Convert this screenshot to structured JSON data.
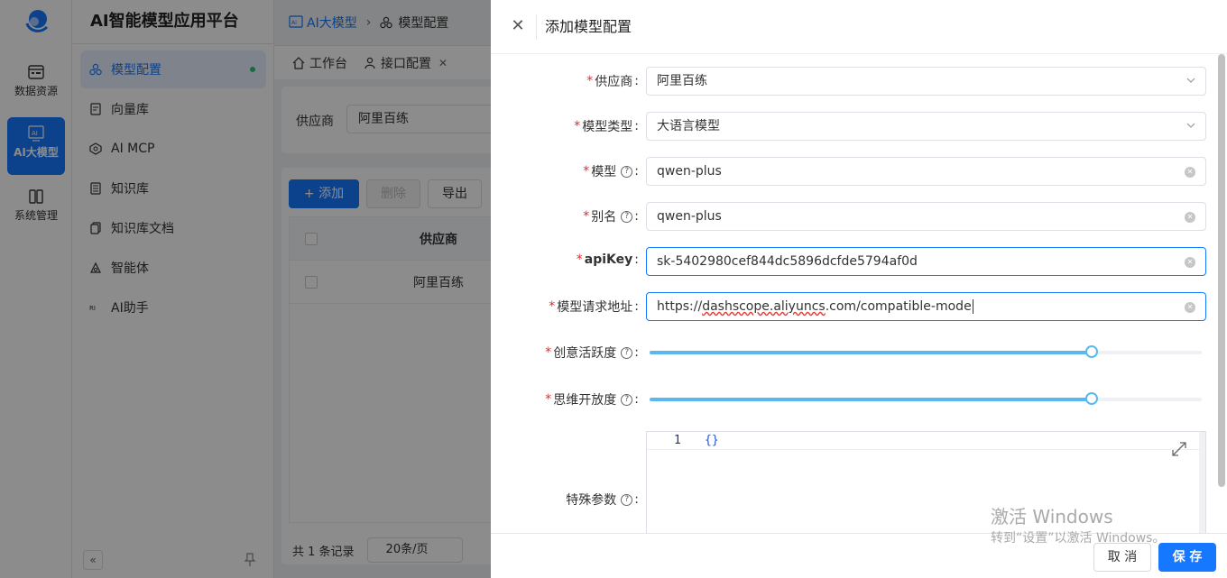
{
  "app": {
    "title": "AI智能模型应用平台"
  },
  "rail": {
    "items": [
      {
        "label": "数据资源",
        "icon": "database-icon"
      },
      {
        "label": "AI大模型",
        "icon": "ai-chip-icon"
      },
      {
        "label": "系统管理",
        "icon": "settings-grid-icon"
      }
    ]
  },
  "sidebar": {
    "items": [
      {
        "label": "模型配置",
        "icon": "model-config-icon"
      },
      {
        "label": "向量库",
        "icon": "vector-db-icon"
      },
      {
        "label": "AI MCP",
        "icon": "mcp-icon"
      },
      {
        "label": "知识库",
        "icon": "knowledge-base-icon"
      },
      {
        "label": "知识库文档",
        "icon": "documents-icon"
      },
      {
        "label": "智能体",
        "icon": "agent-icon"
      },
      {
        "label": "AI助手",
        "icon": "assistant-icon"
      }
    ],
    "collapse_glyph": "«"
  },
  "breadcrumb": {
    "level1": "AI大模型",
    "level2": "模型配置"
  },
  "tabs": [
    {
      "label": "工作台"
    },
    {
      "label": "接口配置"
    }
  ],
  "filter": {
    "label": "供应商",
    "value": "阿里百练"
  },
  "toolbar": {
    "add_label": "+ 添加",
    "delete_label": "删除",
    "export_label": "导出"
  },
  "table": {
    "headers": [
      "供应商"
    ],
    "rows": [
      [
        "阿里百练"
      ]
    ]
  },
  "pager": {
    "total_text": "共 1 条记录",
    "page_size": "20条/页"
  },
  "drawer": {
    "title": "添加模型配置",
    "fields": {
      "provider": {
        "label": "供应商",
        "value": "阿里百练"
      },
      "model_type": {
        "label": "模型类型",
        "value": "大语言模型"
      },
      "model": {
        "label": "模型",
        "value": "qwen-plus"
      },
      "alias": {
        "label": "别名",
        "value": "qwen-plus"
      },
      "api_key": {
        "label": "apiKey",
        "value": "sk-5402980cef844dc5896dcfde5794af0d"
      },
      "url": {
        "label": "模型请求地址",
        "value_prefix": "https://",
        "value_underlined": "dashscope.aliyuncs",
        "value_suffix": ".com/compatible-mode"
      },
      "creativity": {
        "label": "创意活跃度",
        "level": 0.8
      },
      "openness": {
        "label": "思维开放度",
        "level": 0.8
      },
      "special": {
        "label": "特殊参数",
        "line_no": "1",
        "code": "{}"
      }
    },
    "cancel_label": "取 消",
    "save_label": "保 存"
  },
  "watermark": {
    "line1": "激活 Windows",
    "line2": "转到“设置”以激活 Windows。"
  },
  "colors": {
    "primary": "#1677ff",
    "required": "#f5222d",
    "slider": "#5ab8f0",
    "active_dot": "#2fbf71"
  }
}
